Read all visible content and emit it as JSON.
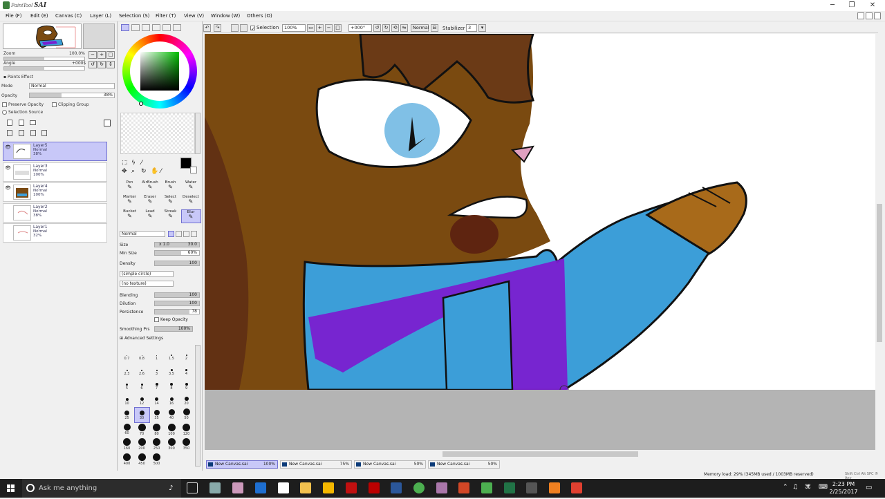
{
  "window": {
    "app_name": "SAI",
    "app_prefix": "PaintTool",
    "minimize": "─",
    "maximize": "❐",
    "close": "✕"
  },
  "menu": [
    "File (F)",
    "Edit (E)",
    "Canvas (C)",
    "Layer (L)",
    "Selection (S)",
    "Filter (T)",
    "View (V)",
    "Window (W)",
    "Others (O)"
  ],
  "navigator": {
    "zoom_label": "Zoom",
    "zoom_value": "100.0%",
    "angle_label": "Angle",
    "angle_value": "+000$"
  },
  "layer_props": {
    "paints_effect": "Paints Effect",
    "mode_label": "Mode",
    "mode_value": "Normal",
    "opacity_label": "Opacity",
    "opacity_value": "38%",
    "preserve_opacity": "Preserve Opacity",
    "clipping_group": "Clipping Group",
    "selection_source": "Selection Source"
  },
  "layers": [
    {
      "name": "Layer5",
      "mode": "Normal",
      "opacity": "38%",
      "selected": true,
      "visible": true
    },
    {
      "name": "Layer3",
      "mode": "Normal",
      "opacity": "100%",
      "selected": false,
      "visible": true
    },
    {
      "name": "Layer4",
      "mode": "Normal",
      "opacity": "100%",
      "selected": false,
      "visible": true
    },
    {
      "name": "Layer2",
      "mode": "Normal",
      "opacity": "38%",
      "selected": false,
      "visible": false
    },
    {
      "name": "Layer1",
      "mode": "Normal",
      "opacity": "32%",
      "selected": false,
      "visible": false
    }
  ],
  "tools": [
    {
      "label": "Pen"
    },
    {
      "label": "AirBrush"
    },
    {
      "label": "Brush"
    },
    {
      "label": "Water"
    },
    {
      "label": "Marker"
    },
    {
      "label": "Eraser"
    },
    {
      "label": "Select"
    },
    {
      "label": "Deselect"
    },
    {
      "label": "Bucket"
    },
    {
      "label": "Lead"
    },
    {
      "label": "Streak"
    },
    {
      "label": "Blur"
    }
  ],
  "brush": {
    "blend_mode": "Normal",
    "size_label": "Size",
    "size_mult": "x 1.0",
    "size_value": "30.0",
    "min_size_label": "Min Size",
    "min_size_value": "60%",
    "density_label": "Density",
    "density_value": "100",
    "shape": "(simple circle)",
    "texture": "(no texture)",
    "blending_label": "Blending",
    "blending_value": "100",
    "dilution_label": "Dilution",
    "dilution_value": "100",
    "persistence_label": "Persistence",
    "persistence_value": "78",
    "keep_opacity": "Keep Opacity",
    "smoothing_label": "Smoothing Prs",
    "smoothing_value": "100%",
    "advanced": "Advanced Settings"
  },
  "brush_sizes": [
    "0.7",
    "0.8",
    "1",
    "1.5",
    "2",
    "2.3",
    "2.6",
    "3",
    "3.5",
    "4",
    "5",
    "6",
    "7",
    "8",
    "9",
    "10",
    "12",
    "14",
    "16",
    "20",
    "25",
    "30",
    "35",
    "40",
    "50",
    "60",
    "70",
    "80",
    "100",
    "120",
    "160",
    "200",
    "250",
    "300",
    "350",
    "400",
    "450",
    "500"
  ],
  "selected_brush_size": "30",
  "toolbar": {
    "selection_label": "Selection",
    "zoom": "100%",
    "angle": "+000°",
    "blend": "Normal",
    "stabilizer_label": "Stabilizer",
    "stabilizer_value": "3"
  },
  "documents": [
    {
      "name": "New Canvas.sai",
      "zoom": "100%",
      "selected": true
    },
    {
      "name": "New Canvas.sai",
      "zoom": "75%",
      "selected": false
    },
    {
      "name": "New Canvas.sai",
      "zoom": "50%",
      "selected": false
    },
    {
      "name": "New Canvas.sai",
      "zoom": "50%",
      "selected": false
    }
  ],
  "status": {
    "memory": "Memory load: 29% (345MB used / 1003MB reserved)",
    "keys": "Shift Ctrl Alt SPC ® Any"
  },
  "taskbar": {
    "search_placeholder": "Ask me anything",
    "time": "2:23 PM",
    "date": "2/25/2017"
  },
  "colors": {
    "accent_select": "#c8c8f8",
    "skin": "#7a4a12",
    "shirt_blue": "#3c9ed8",
    "stripe_purple": "#7a1fd0",
    "hair": "#6b3a16"
  }
}
